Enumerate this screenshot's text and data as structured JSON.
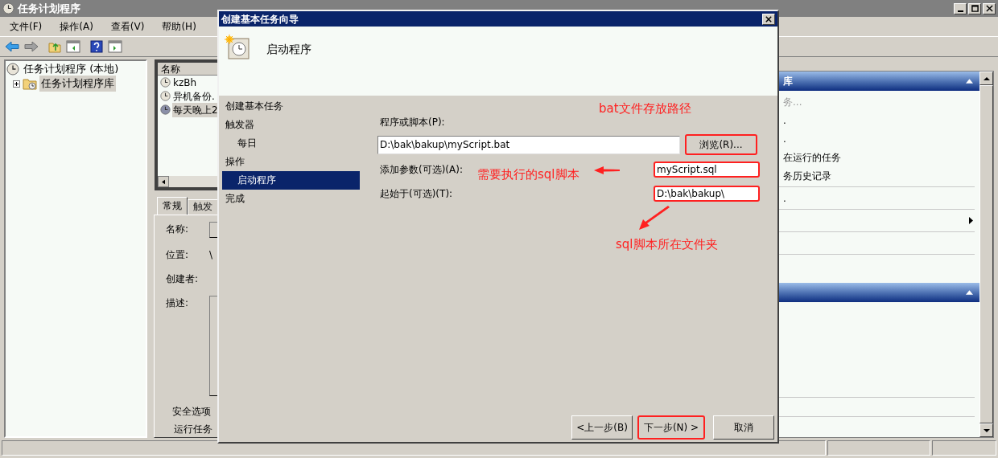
{
  "window": {
    "title": "任务计划程序"
  },
  "menu": [
    "文件(F)",
    "操作(A)",
    "查看(V)",
    "帮助(H)"
  ],
  "tree": [
    {
      "label": "任务计划程序 (本地)",
      "selected": false,
      "children": [
        {
          "label": "任务计划程序库",
          "selected": true,
          "expanded": false
        }
      ]
    }
  ],
  "task_list": {
    "columns": [
      "名称"
    ],
    "rows": [
      {
        "name": "kzBh",
        "selected": false
      },
      {
        "name": "异机备份.",
        "selected": false
      },
      {
        "name": "每天晚上2",
        "selected": true
      }
    ]
  },
  "details": {
    "tabs": [
      {
        "label": "常规",
        "selected": true
      },
      {
        "label": "触发",
        "selected": false
      }
    ],
    "fields": [
      {
        "label": "名称:",
        "kind": "input"
      },
      {
        "label": "位置:",
        "kind": "text",
        "value": "\\"
      },
      {
        "label": "创建者:",
        "kind": "text"
      },
      {
        "label": "描述:",
        "kind": "textarea"
      }
    ],
    "section": "安全选项",
    "section_text": "运行任务"
  },
  "actions": {
    "title": "库",
    "expanded": true,
    "groups": [
      [
        {
          "label": "务...",
          "disabled": true
        },
        {
          "label": ".",
          "disabled": false
        },
        {
          "label": ".",
          "disabled": false
        },
        {
          "label": "在运行的任务",
          "disabled": false
        },
        {
          "label": "务历史记录",
          "disabled": false
        }
      ],
      [
        {
          "label": ".",
          "disabled": false
        }
      ],
      [
        {
          "kind": "submenu"
        }
      ],
      [
        {
          "kind": "blank"
        }
      ],
      [
        {
          "kind": "blank"
        }
      ]
    ],
    "second_expanded": true
  },
  "dialog": {
    "title": "创建基本任务向导",
    "heading": "启动程序",
    "steps": [
      {
        "label": "创建基本任务",
        "selected": false
      },
      {
        "label": "触发器",
        "selected": false,
        "children": [
          {
            "label": "每日",
            "selected": false
          }
        ]
      },
      {
        "label": "操作",
        "selected": false,
        "children": [
          {
            "label": "启动程序",
            "selected": true
          }
        ]
      },
      {
        "label": "完成",
        "selected": false
      }
    ],
    "program": {
      "label": "程序或脚本(P):",
      "value": "D:\\bak\\bakup\\myScript.bat",
      "highlighted": false
    },
    "browse_button": {
      "label": "浏览(R)...",
      "highlighted": true
    },
    "fields": [
      {
        "label": "添加参数(可选)(A):",
        "value": "myScript.sql",
        "highlighted": true
      },
      {
        "label": "起始于(可选)(T):",
        "value": "D:\\bak\\bakup\\",
        "highlighted": true
      }
    ],
    "buttons": [
      {
        "label": "<上一步(B)",
        "highlighted": false
      },
      {
        "label": "下一步(N) >",
        "highlighted": true
      },
      {
        "label": "取消",
        "highlighted": false
      }
    ]
  },
  "annotations": [
    {
      "kind": "text",
      "text": "bat文件存放路径"
    },
    {
      "kind": "text",
      "text": "需要执行的sql脚本"
    },
    {
      "kind": "left_arrow"
    },
    {
      "kind": "text",
      "text": "sql脚本所在文件夹"
    },
    {
      "kind": "down_arrow"
    }
  ]
}
